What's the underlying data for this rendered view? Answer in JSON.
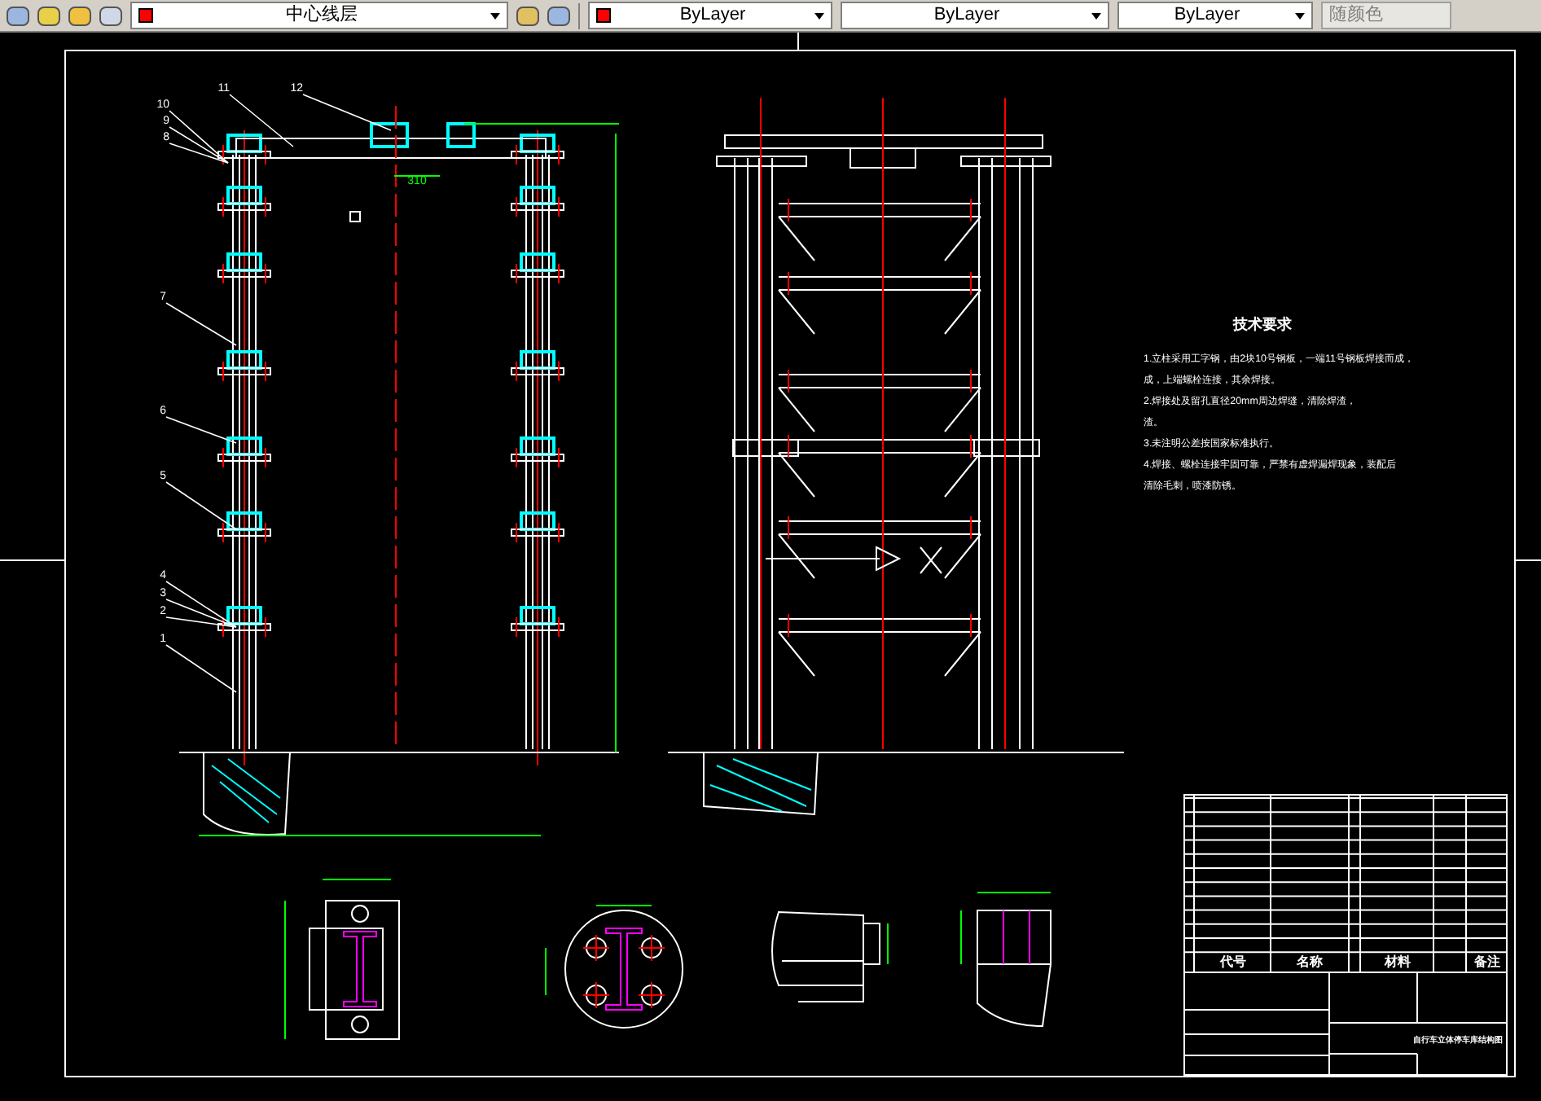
{
  "toolbar": {
    "layer": "中心线层",
    "color_control": "ByLayer",
    "linetype": "ByLayer",
    "lineweight": "ByLayer",
    "plot_style": "随颜色"
  },
  "drawing": {
    "part_labels": [
      "10",
      "9",
      "8",
      "11",
      "12",
      "7",
      "6",
      "5",
      "4",
      "3",
      "2",
      "1"
    ],
    "dimension": "310",
    "tech_title": "技术要求",
    "tech_lines": [
      "1.立柱采用工字钢，由2块10号钢板，一端11号钢板焊接而成，",
      "成，上端螺栓连接，其余焊接。",
      "2.焊接处及留孔直径20mm周边焊缝，清除焊渣，",
      "渣。",
      "3.未注明公差按国家标准执行。",
      "4.焊接、螺栓连接牢固可靠，严禁有虚焊漏焊现象，装配后",
      "清除毛刺，喷漆防锈。"
    ],
    "title_block": {
      "headers": [
        "代号",
        "名称",
        "材料",
        "备注"
      ],
      "title": "自行车立体停车库结构图"
    }
  }
}
